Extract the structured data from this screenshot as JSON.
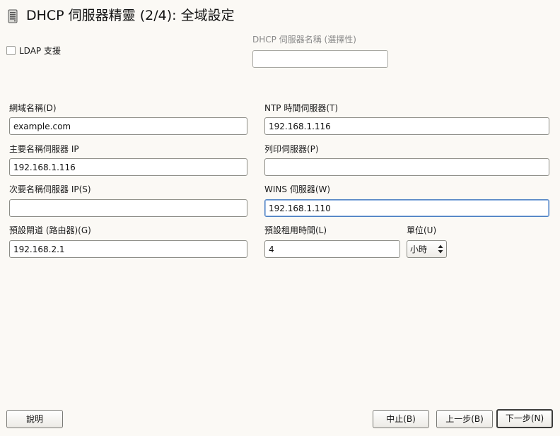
{
  "window": {
    "title": "DHCP 伺服器精靈 (2/4): 全域設定"
  },
  "ldap": {
    "label": "LDAP 支援",
    "checked": false
  },
  "server_name": {
    "label": "DHCP 伺服器名稱 (選擇性)",
    "value": ""
  },
  "fields": {
    "domain_name": {
      "label": "網域名稱(D)",
      "value": "example.com"
    },
    "ntp_server": {
      "label": "NTP 時間伺服器(T)",
      "value": "192.168.1.116"
    },
    "primary_dns": {
      "label": "主要名稱伺服器 IP",
      "value": "192.168.1.116"
    },
    "print_server": {
      "label": "列印伺服器(P)",
      "value": ""
    },
    "secondary_dns": {
      "label": "次要名稱伺服器 IP(S)",
      "value": ""
    },
    "wins_server": {
      "label": "WINS 伺服器(W)",
      "value": "192.168.1.110"
    },
    "default_gateway": {
      "label": "預設閘道 (路由器)(G)",
      "value": "192.168.2.1"
    },
    "lease_time": {
      "label": "預設租用時間(L)",
      "value": "4"
    },
    "unit": {
      "label": "單位(U)",
      "value": "小時"
    }
  },
  "buttons": {
    "help": "說明",
    "abort": "中止(B)",
    "back": "上一步(B)",
    "next": "下一步(N)"
  }
}
